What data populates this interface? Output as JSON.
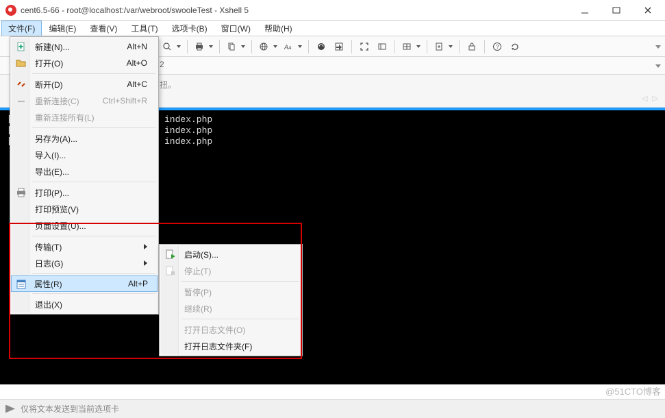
{
  "title": "cent6.5-66 - root@localhost:/var/webroot/swooleTest - Xshell 5",
  "menubar": {
    "file": "文件(F)",
    "edit": "编辑(E)",
    "view": "查看(V)",
    "tools": "工具(T)",
    "tabs": "选项卡(B)",
    "window": "窗口(W)",
    "help": "帮助(H)"
  },
  "toolbar_fragments": {
    "tab_frag": "2",
    "banner_frag": "扭。"
  },
  "file_menu": {
    "new": {
      "label": "新建(N)...",
      "shortcut": "Alt+N"
    },
    "open": {
      "label": "打开(O)",
      "shortcut": "Alt+O"
    },
    "disconnect": {
      "label": "断开(D)",
      "shortcut": "Alt+C"
    },
    "reconnect": {
      "label": "重新连接(C)",
      "shortcut": "Ctrl+Shift+R"
    },
    "reconnect_all": {
      "label": "重新连接所有(L)"
    },
    "save_as": {
      "label": "另存为(A)..."
    },
    "import": {
      "label": "导入(I)..."
    },
    "export": {
      "label": "导出(E)..."
    },
    "print": {
      "label": "打印(P)..."
    },
    "print_preview": {
      "label": "打印预览(V)"
    },
    "page_setup": {
      "label": "页面设置(U)..."
    },
    "transfer": {
      "label": "传输(T)"
    },
    "log": {
      "label": "日志(G)"
    },
    "properties": {
      "label": "属性(R)",
      "shortcut": "Alt+P"
    },
    "exit": {
      "label": "退出(X)"
    }
  },
  "log_submenu": {
    "start": {
      "label": "启动(S)..."
    },
    "stop": {
      "label": "停止(T)"
    },
    "pause": {
      "label": "暂停(P)"
    },
    "resume": {
      "label": "继续(R)"
    },
    "open_log_file": {
      "label": "打开日志文件(O)"
    },
    "open_log_folder": {
      "label": "打开日志文件夹(F)"
    }
  },
  "terminal_lines": {
    "l1": "index.php",
    "l2": "index.php",
    "l3": "index.php"
  },
  "status": {
    "text": "仅将文本发送到当前选项卡"
  },
  "watermark": "@51CTO博客",
  "banner_arrows": "◁ ▷"
}
